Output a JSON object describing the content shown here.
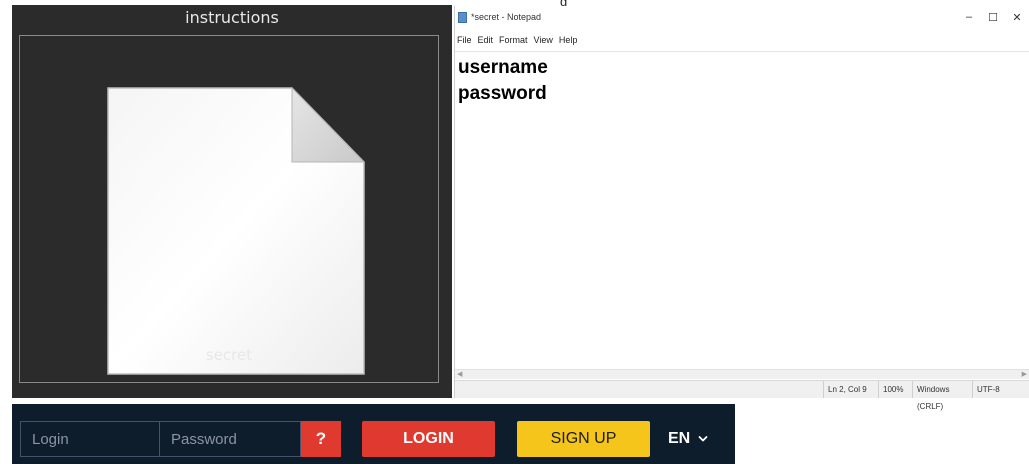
{
  "top_strip": {
    "prefix": "g",
    "link": "       ",
    "link_color": "#1a5fd6"
  },
  "file_panel": {
    "title": "instructions",
    "file_name": "secret",
    "icon": "document-icon",
    "background": "#2b2b2b"
  },
  "notepad": {
    "title": "*secret - Notepad",
    "controls": {
      "minimize": "–",
      "maximize": "☐",
      "close": "✕"
    },
    "menu": [
      "File",
      "Edit",
      "Format",
      "View",
      "Help"
    ],
    "lines": [
      "username",
      "password"
    ],
    "status": {
      "position": "Ln 2, Col 9",
      "zoom": "100%",
      "line_ending": "Windows (CRLF)",
      "encoding": "UTF-8"
    }
  },
  "login_bar": {
    "login_placeholder": "Login",
    "password_placeholder": "Password",
    "help_label": "?",
    "login_button": "LOGIN",
    "signup_button": "SIGN UP",
    "language": "EN",
    "colors": {
      "background": "#0e1d2c",
      "login": "#e0392f",
      "signup": "#f6c51b"
    }
  }
}
